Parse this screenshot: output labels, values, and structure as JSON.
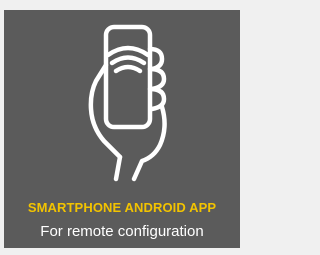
{
  "card": {
    "icon": "hand-holding-phone-wifi-icon",
    "title": "SMARTPHONE ANDROID APP",
    "subtitle": "For remote configuration",
    "colors": {
      "background": "#5b5b5b",
      "title": "#f2c300",
      "subtitle": "#ffffff",
      "icon": "#ffffff"
    }
  }
}
